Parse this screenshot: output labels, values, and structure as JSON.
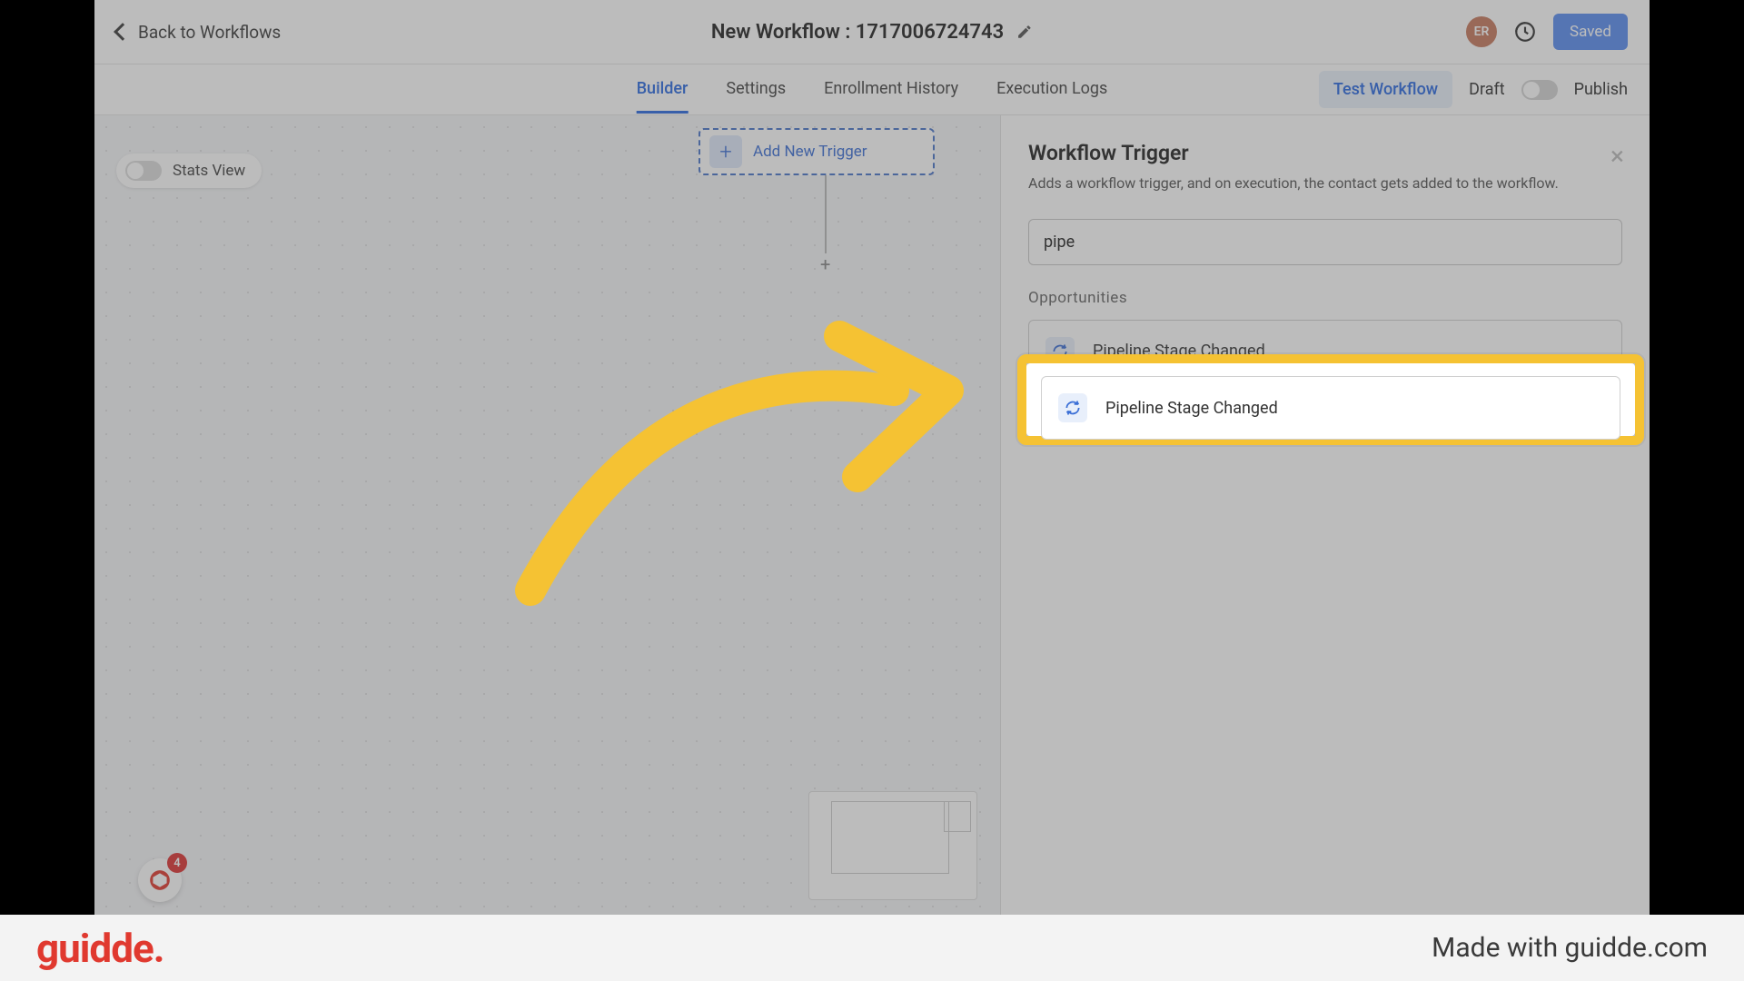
{
  "header": {
    "back_label": "Back to Workflows",
    "title": "New Workflow : 1717006724743",
    "avatar_initials": "ER",
    "saved_label": "Saved"
  },
  "tabs": {
    "items": [
      "Builder",
      "Settings",
      "Enrollment History",
      "Execution Logs"
    ],
    "active_index": 0,
    "test_label": "Test Workflow",
    "draft_label": "Draft",
    "publish_label": "Publish"
  },
  "canvas": {
    "stats_view_label": "Stats View",
    "add_trigger_label": "Add New Trigger"
  },
  "panel": {
    "title": "Workflow Trigger",
    "description": "Adds a workflow trigger, and on execution, the contact gets added to the workflow.",
    "search_value": "pipe",
    "section_label": "Opportunities",
    "option_label": "Pipeline Stage Changed"
  },
  "fab": {
    "badge_count": "4"
  },
  "footer": {
    "brand": "guidde.",
    "credit": "Made with guidde.com"
  }
}
